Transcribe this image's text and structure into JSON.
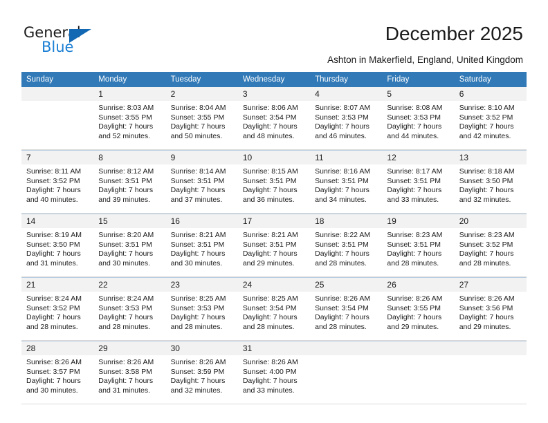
{
  "brand": {
    "name_part1": "General",
    "name_part2": "Blue"
  },
  "header": {
    "title": "December 2025",
    "subtitle": "Ashton in Makerfield, England, United Kingdom"
  },
  "colors": {
    "header_blue": "#3179b7",
    "logo_blue": "#1b7fd4",
    "day_band": "#f2f2f2"
  },
  "calendar": {
    "weekday_headers": [
      "Sunday",
      "Monday",
      "Tuesday",
      "Wednesday",
      "Thursday",
      "Friday",
      "Saturday"
    ],
    "weeks": [
      [
        {
          "day": "",
          "lines": []
        },
        {
          "day": "1",
          "lines": [
            "Sunrise: 8:03 AM",
            "Sunset: 3:55 PM",
            "Daylight: 7 hours",
            "and 52 minutes."
          ]
        },
        {
          "day": "2",
          "lines": [
            "Sunrise: 8:04 AM",
            "Sunset: 3:55 PM",
            "Daylight: 7 hours",
            "and 50 minutes."
          ]
        },
        {
          "day": "3",
          "lines": [
            "Sunrise: 8:06 AM",
            "Sunset: 3:54 PM",
            "Daylight: 7 hours",
            "and 48 minutes."
          ]
        },
        {
          "day": "4",
          "lines": [
            "Sunrise: 8:07 AM",
            "Sunset: 3:53 PM",
            "Daylight: 7 hours",
            "and 46 minutes."
          ]
        },
        {
          "day": "5",
          "lines": [
            "Sunrise: 8:08 AM",
            "Sunset: 3:53 PM",
            "Daylight: 7 hours",
            "and 44 minutes."
          ]
        },
        {
          "day": "6",
          "lines": [
            "Sunrise: 8:10 AM",
            "Sunset: 3:52 PM",
            "Daylight: 7 hours",
            "and 42 minutes."
          ]
        }
      ],
      [
        {
          "day": "7",
          "lines": [
            "Sunrise: 8:11 AM",
            "Sunset: 3:52 PM",
            "Daylight: 7 hours",
            "and 40 minutes."
          ]
        },
        {
          "day": "8",
          "lines": [
            "Sunrise: 8:12 AM",
            "Sunset: 3:51 PM",
            "Daylight: 7 hours",
            "and 39 minutes."
          ]
        },
        {
          "day": "9",
          "lines": [
            "Sunrise: 8:14 AM",
            "Sunset: 3:51 PM",
            "Daylight: 7 hours",
            "and 37 minutes."
          ]
        },
        {
          "day": "10",
          "lines": [
            "Sunrise: 8:15 AM",
            "Sunset: 3:51 PM",
            "Daylight: 7 hours",
            "and 36 minutes."
          ]
        },
        {
          "day": "11",
          "lines": [
            "Sunrise: 8:16 AM",
            "Sunset: 3:51 PM",
            "Daylight: 7 hours",
            "and 34 minutes."
          ]
        },
        {
          "day": "12",
          "lines": [
            "Sunrise: 8:17 AM",
            "Sunset: 3:51 PM",
            "Daylight: 7 hours",
            "and 33 minutes."
          ]
        },
        {
          "day": "13",
          "lines": [
            "Sunrise: 8:18 AM",
            "Sunset: 3:50 PM",
            "Daylight: 7 hours",
            "and 32 minutes."
          ]
        }
      ],
      [
        {
          "day": "14",
          "lines": [
            "Sunrise: 8:19 AM",
            "Sunset: 3:50 PM",
            "Daylight: 7 hours",
            "and 31 minutes."
          ]
        },
        {
          "day": "15",
          "lines": [
            "Sunrise: 8:20 AM",
            "Sunset: 3:51 PM",
            "Daylight: 7 hours",
            "and 30 minutes."
          ]
        },
        {
          "day": "16",
          "lines": [
            "Sunrise: 8:21 AM",
            "Sunset: 3:51 PM",
            "Daylight: 7 hours",
            "and 30 minutes."
          ]
        },
        {
          "day": "17",
          "lines": [
            "Sunrise: 8:21 AM",
            "Sunset: 3:51 PM",
            "Daylight: 7 hours",
            "and 29 minutes."
          ]
        },
        {
          "day": "18",
          "lines": [
            "Sunrise: 8:22 AM",
            "Sunset: 3:51 PM",
            "Daylight: 7 hours",
            "and 28 minutes."
          ]
        },
        {
          "day": "19",
          "lines": [
            "Sunrise: 8:23 AM",
            "Sunset: 3:51 PM",
            "Daylight: 7 hours",
            "and 28 minutes."
          ]
        },
        {
          "day": "20",
          "lines": [
            "Sunrise: 8:23 AM",
            "Sunset: 3:52 PM",
            "Daylight: 7 hours",
            "and 28 minutes."
          ]
        }
      ],
      [
        {
          "day": "21",
          "lines": [
            "Sunrise: 8:24 AM",
            "Sunset: 3:52 PM",
            "Daylight: 7 hours",
            "and 28 minutes."
          ]
        },
        {
          "day": "22",
          "lines": [
            "Sunrise: 8:24 AM",
            "Sunset: 3:53 PM",
            "Daylight: 7 hours",
            "and 28 minutes."
          ]
        },
        {
          "day": "23",
          "lines": [
            "Sunrise: 8:25 AM",
            "Sunset: 3:53 PM",
            "Daylight: 7 hours",
            "and 28 minutes."
          ]
        },
        {
          "day": "24",
          "lines": [
            "Sunrise: 8:25 AM",
            "Sunset: 3:54 PM",
            "Daylight: 7 hours",
            "and 28 minutes."
          ]
        },
        {
          "day": "25",
          "lines": [
            "Sunrise: 8:26 AM",
            "Sunset: 3:54 PM",
            "Daylight: 7 hours",
            "and 28 minutes."
          ]
        },
        {
          "day": "26",
          "lines": [
            "Sunrise: 8:26 AM",
            "Sunset: 3:55 PM",
            "Daylight: 7 hours",
            "and 29 minutes."
          ]
        },
        {
          "day": "27",
          "lines": [
            "Sunrise: 8:26 AM",
            "Sunset: 3:56 PM",
            "Daylight: 7 hours",
            "and 29 minutes."
          ]
        }
      ],
      [
        {
          "day": "28",
          "lines": [
            "Sunrise: 8:26 AM",
            "Sunset: 3:57 PM",
            "Daylight: 7 hours",
            "and 30 minutes."
          ]
        },
        {
          "day": "29",
          "lines": [
            "Sunrise: 8:26 AM",
            "Sunset: 3:58 PM",
            "Daylight: 7 hours",
            "and 31 minutes."
          ]
        },
        {
          "day": "30",
          "lines": [
            "Sunrise: 8:26 AM",
            "Sunset: 3:59 PM",
            "Daylight: 7 hours",
            "and 32 minutes."
          ]
        },
        {
          "day": "31",
          "lines": [
            "Sunrise: 8:26 AM",
            "Sunset: 4:00 PM",
            "Daylight: 7 hours",
            "and 33 minutes."
          ]
        },
        {
          "day": "",
          "lines": []
        },
        {
          "day": "",
          "lines": []
        },
        {
          "day": "",
          "lines": []
        }
      ]
    ]
  }
}
